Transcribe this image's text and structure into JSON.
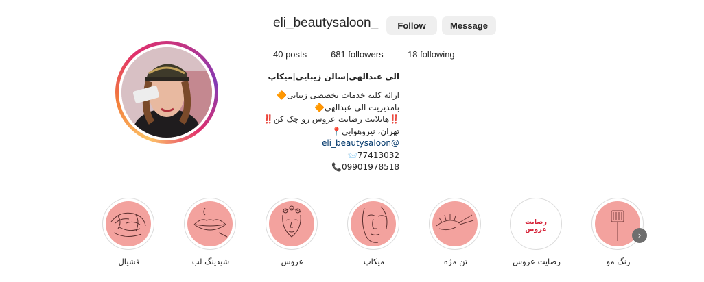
{
  "profile": {
    "username": "eli_beautysaloon_",
    "follow_label": "Follow",
    "message_label": "Message",
    "stats": {
      "posts": "40 posts",
      "followers": "681 followers",
      "following": "18 following"
    },
    "bio": {
      "name": "الی عبدالهی|سالن زیبایی|میکاپ",
      "lines": [
        "ارائه کلیه خدمات تخصصی زیبایی🔶",
        "بامدیریت الی عبدالهی🔶",
        "‼️هایلایت رضایت عروس رو چک کن‼️",
        "تهران، نیروهوایی📍",
        "@eli_beautysaloon",
        "77413032📨",
        "09901978518📞"
      ]
    }
  },
  "highlights": [
    {
      "label": "رنگ مو",
      "icon": "hair-brush-icon"
    },
    {
      "label": "رضایت عروس",
      "icon": "text-icon",
      "circle_text": "رضایت عروس"
    },
    {
      "label": "تن مژه",
      "icon": "eyelash-icon"
    },
    {
      "label": "میکاپ",
      "icon": "face-line-icon"
    },
    {
      "label": "عروس",
      "icon": "bride-icon"
    },
    {
      "label": "شیدینگ لب",
      "icon": "lips-icon"
    },
    {
      "label": "فشیال",
      "icon": "facial-icon"
    }
  ],
  "colors": {
    "highlight_bg": "#f3a29e",
    "button_bg": "#efefef",
    "link": "#00376b",
    "circle_text": "#d6243a"
  },
  "next_arrow": "›"
}
